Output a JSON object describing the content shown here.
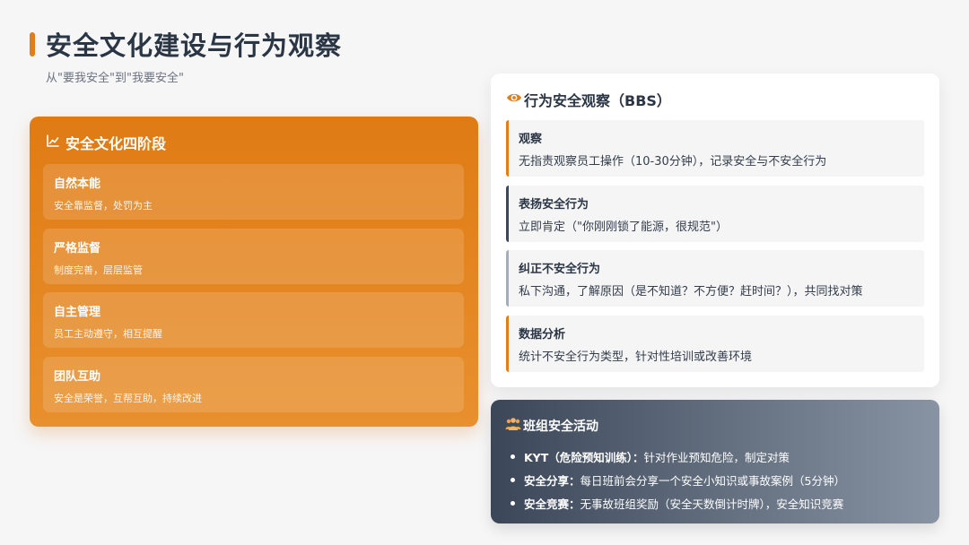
{
  "header": {
    "title": "安全文化建设与行为观察",
    "subtitle": "从\"要我安全\"到\"我要安全\""
  },
  "stages": {
    "title": "安全文化四阶段",
    "icon": "line-chart-icon",
    "items": [
      {
        "name": "自然本能",
        "desc": "安全靠监督，处罚为主"
      },
      {
        "name": "严格监督",
        "desc": "制度完善，层层监管"
      },
      {
        "name": "自主管理",
        "desc": "员工主动遵守，相互提醒"
      },
      {
        "name": "团队互助",
        "desc": "安全是荣誉，互帮互助，持续改进"
      }
    ]
  },
  "bbs": {
    "title": "行为安全观察（BBS）",
    "icon": "eye-icon",
    "items": [
      {
        "name": "观察",
        "desc": "无指责观察员工操作（10-30分钟），记录安全与不安全行为"
      },
      {
        "name": "表扬安全行为",
        "desc": "立即肯定（\"你刚刚锁了能源，很规范\"）"
      },
      {
        "name": "纠正不安全行为",
        "desc": "私下沟通，了解原因（是不知道？不方便？赶时间？），共同找对策"
      },
      {
        "name": "数据分析",
        "desc": "统计不安全行为类型，针对性培训或改善环境"
      }
    ]
  },
  "team": {
    "title": "班组安全活动",
    "icon": "people-icon",
    "items": [
      {
        "key": "KYT（危险预知训练）：",
        "text": "针对作业预知危险，制定对策"
      },
      {
        "key": "安全分享：",
        "text": "每日班前会分享一个安全小知识或事故案例（5分钟）"
      },
      {
        "key": "安全竞赛：",
        "text": "无事故班组奖励（安全天数倒计时牌），安全知识竞赛"
      }
    ]
  },
  "colors": {
    "accent": "#e07e1a",
    "dark": "#3b4758",
    "grey": "#a5adb8"
  }
}
